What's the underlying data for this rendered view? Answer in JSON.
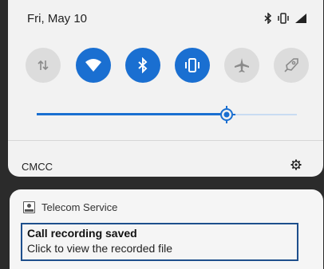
{
  "status_bar": {
    "date": "Fri, May 10",
    "icons": [
      "bluetooth-icon",
      "vibrate-icon",
      "cell-signal-icon"
    ]
  },
  "quick_settings": {
    "tiles": [
      {
        "name": "mobile-data",
        "icon": "data-arrows-icon",
        "active": false
      },
      {
        "name": "wifi",
        "icon": "wifi-question-icon",
        "active": true
      },
      {
        "name": "bluetooth",
        "icon": "bluetooth-icon",
        "active": true
      },
      {
        "name": "vibrate",
        "icon": "vibrate-icon",
        "active": true
      },
      {
        "name": "airplane-mode",
        "icon": "airplane-icon",
        "active": false
      },
      {
        "name": "performance",
        "icon": "rocket-icon",
        "active": false
      }
    ],
    "brightness": {
      "level": 0.73,
      "icon": "brightness-icon"
    },
    "colors": {
      "active": "#1a6fd1",
      "inactive": "#dcdcdc",
      "track": "#c9dcf2"
    }
  },
  "carrier_row": {
    "carrier": "CMCC",
    "settings_icon": "settings-gear-icon"
  },
  "notification": {
    "app_icon": "recorder-icon",
    "app_name": "Telecom Service",
    "title": "Call recording saved",
    "text": "Click to view the recorded file"
  }
}
